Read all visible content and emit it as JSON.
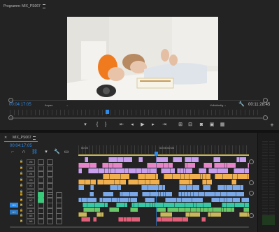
{
  "program_monitor": {
    "title": "Programm: MIX_PS067",
    "menu_icon": "hamburger-icon",
    "current_timecode": "00:04:17:05",
    "fit_label": "Anpas",
    "quality_label": "Vollständig",
    "wrench_icon": "wrench-icon",
    "duration_timecode": "00:11:28:45"
  },
  "transport": {
    "buttons": [
      "add-marker-icon",
      "mark-in-icon",
      "mark-out-icon",
      "go-to-in-icon",
      "step-back-icon",
      "play-icon",
      "step-forward-icon",
      "go-to-out-icon",
      "lift-icon",
      "extract-icon",
      "export-frame-icon",
      "comparison-icon",
      "multi-camera-icon"
    ],
    "add_icon": "plus-icon"
  },
  "timeline": {
    "title": "MIX_PS067",
    "current_timecode": "00:04:17:05",
    "ruler_labels": [
      "00:00",
      "00:05:00:00"
    ],
    "video_track_names": [
      "V6",
      "V5",
      "V4",
      "V3",
      "V2",
      "V1"
    ],
    "audio_track_names": [
      "A1",
      "A2",
      "A3",
      "A4",
      "A5",
      "A6"
    ],
    "source_patch_label": "V1",
    "audio_source_patch_label": "A1"
  },
  "colors": {
    "accent": "#2d8ceb",
    "clip_violet": "#c9a0f0",
    "clip_pink": "#e686c8",
    "clip_orange": "#f0b050",
    "clip_blue": "#7aa8e8",
    "clip_teal": "#38c8a8",
    "clip_green": "#6ac66a",
    "clip_gold": "#c9b85a",
    "clip_red": "#e0607a"
  }
}
